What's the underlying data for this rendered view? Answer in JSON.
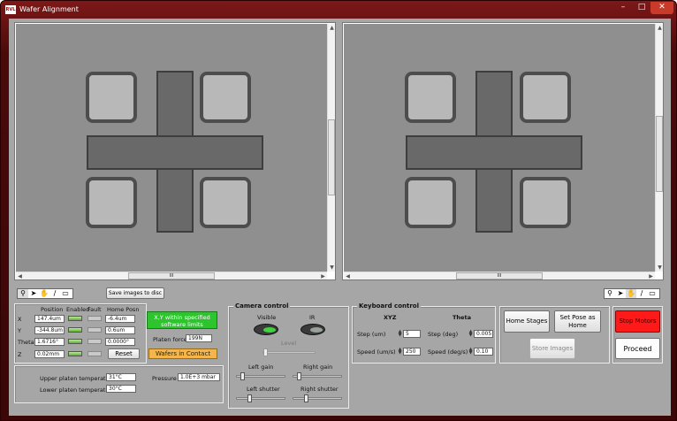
{
  "window": {
    "title": "Wafer Alignment",
    "logo_text": "RVL"
  },
  "left_view": {
    "scroll_label": "III",
    "vscroll_label": "III"
  },
  "right_view": {
    "scroll_label": "III",
    "vscroll_label": "III"
  },
  "toolbar": {
    "save_images_label": "Save images to disc"
  },
  "stage_table": {
    "headers": {
      "position": "Position",
      "enabled": "Enabled",
      "fault": "Fault",
      "home_posn": "Home Posn"
    },
    "rows": [
      {
        "axis": "X",
        "position": "147.4um",
        "home": "-6.4um"
      },
      {
        "axis": "Y",
        "position": "-344.8um",
        "home": "0.6um"
      },
      {
        "axis": "Theta",
        "position": "1.6716°",
        "home": "0.0000°"
      },
      {
        "axis": "Z",
        "position": "0.02mm"
      }
    ],
    "reset_label": "Reset"
  },
  "status": {
    "limits_label": "X,Y within specified software limits",
    "platen_force_label": "Platen force",
    "platen_force_value": "199N",
    "contact_label": "Wafers in Contact"
  },
  "temps": {
    "upper_label": "Upper platen temperature",
    "upper_value": "31°C",
    "lower_label": "Lower platen temperature",
    "lower_value": "30°C",
    "pressure_label": "Pressure",
    "pressure_value": "1.0E+3 mbar"
  },
  "camera": {
    "title": "Camera control",
    "visible_label": "Visible",
    "ir_label": "IR",
    "level_label": "Level",
    "left_gain_label": "Left gain",
    "right_gain_label": "Right gain",
    "left_shutter_label": "Left shutter",
    "right_shutter_label": "Right shutter"
  },
  "keyboard": {
    "title": "Keyboard control",
    "xyz_header": "XYZ",
    "theta_header": "Theta",
    "step_um_label": "Step (um)",
    "step_um_value": "5",
    "speed_um_label": "Speed (um/s)",
    "speed_um_value": "250",
    "step_deg_label": "Step (deg)",
    "step_deg_value": "0.005",
    "speed_deg_label": "Speed (deg/s)",
    "speed_deg_value": "0.10"
  },
  "home_buttons": {
    "home_stages": "Home Stages",
    "set_pose_home": "Set Pose as Home",
    "store_images": "Store Images"
  },
  "actions": {
    "stop_motors": "Stop Motors",
    "proceed": "Proceed"
  },
  "colors": {
    "stop": "#ff1a1a",
    "green_status": "#2dc52d",
    "contact": "#f4b64b"
  }
}
